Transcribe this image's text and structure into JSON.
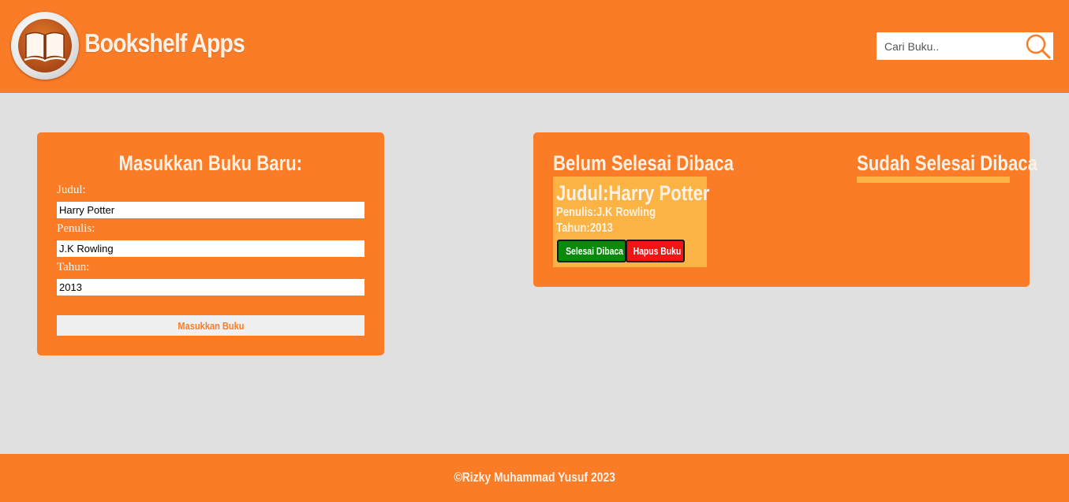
{
  "header": {
    "logo_icon": "open-book-icon",
    "title": "Bookshelf Apps",
    "search": {
      "placeholder": "Cari Buku..",
      "icon": "search-icon"
    }
  },
  "form": {
    "title": "Masukkan Buku Baru:",
    "title_label": "Judul:",
    "title_value": "Harry Potter",
    "author_label": "Penulis:",
    "author_value": "J.K Rowling",
    "year_label": "Tahun:",
    "year_value": "2013",
    "submit_label": "Masukkan Buku"
  },
  "shelf": {
    "unread_title": "Belum Selesai Dibaca",
    "read_title": "Sudah Selesai Dibaca",
    "books": [
      {
        "title": "Judul:Harry Potter",
        "author": "Penulis:J.K Rowling",
        "year": "Tahun:2013",
        "done_label": "Selesai Dibaca",
        "delete_label": "Hapus Buku"
      }
    ]
  },
  "footer": {
    "text": "©Rizky Muhammad Yusuf 2023"
  },
  "colors": {
    "primary": "#fb7c26",
    "background": "#e0e0e0",
    "book_card": "#fbb444",
    "done_button": "#0a8a0a",
    "delete_button": "#f01515"
  }
}
